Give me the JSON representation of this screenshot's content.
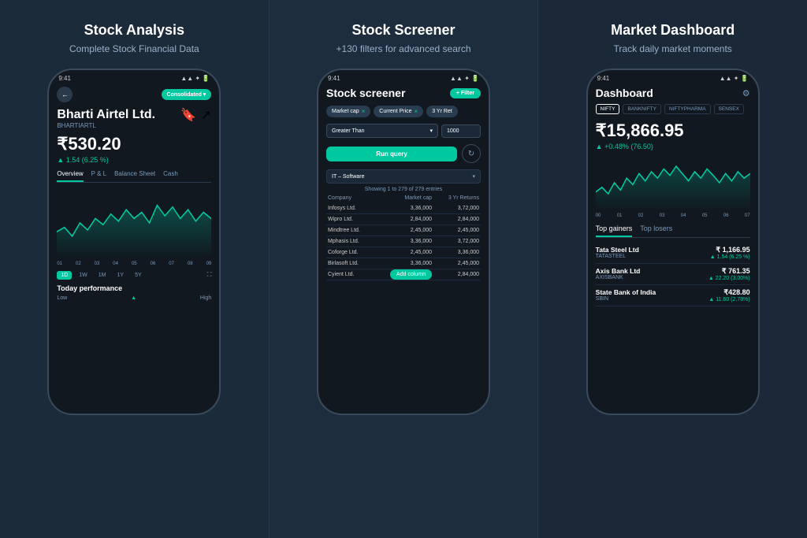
{
  "panels": [
    {
      "id": "panel-1",
      "title": "Stock Analysis",
      "subtitle": "Complete Stock Financial Data",
      "screen": {
        "status_time": "9:41",
        "back_label": "←",
        "badge": "Consolidated ▾",
        "company_name": "Bharti Airtel Ltd.",
        "ticker": "BHARTIARTL",
        "price": "₹530.20",
        "change": "▲ 1.54 (6.25 %)",
        "tabs": [
          "Overview",
          "P & L",
          "Balance Sheet",
          "Cash"
        ],
        "active_tab": "Overview",
        "chart_axis": [
          "01",
          "02",
          "03",
          "04",
          "05",
          "06",
          "07",
          "08",
          "09"
        ],
        "time_buttons": [
          "1D",
          "1W",
          "1M",
          "1Y",
          "5Y"
        ],
        "active_time": "1D",
        "today_perf": "Today performance",
        "perf_low": "Low",
        "perf_high": "High"
      }
    },
    {
      "id": "panel-2",
      "title": "Stock Screener",
      "subtitle": "+130 filters for advanced search",
      "screen": {
        "status_time": "9:41",
        "title": "Stock screener",
        "filter_btn": "+ Filter",
        "tags": [
          "Market cap ×",
          "Current Price ×",
          "3 Yr Ret"
        ],
        "dropdown_label": "Greater Than",
        "input_value": "1000",
        "run_query": "Run query",
        "sector": "IT – Software",
        "count_label": "Showing 1 to 279 of 279 entries",
        "table_headers": [
          "Company",
          "Market cap",
          "3 Yr Returns"
        ],
        "rows": [
          {
            "company": "Infosys Ltd.",
            "mcap": "3,36,000",
            "ret": "3,72,000"
          },
          {
            "company": "Wipro Ltd.",
            "mcap": "2,84,000",
            "ret": "2,84,000"
          },
          {
            "company": "Mindtree Ltd.",
            "mcap": "2,45,000",
            "ret": "2,45,000"
          },
          {
            "company": "Mphasis Ltd.",
            "mcap": "3,36,000",
            "ret": "3,72,000"
          },
          {
            "company": "Coforge Ltd.",
            "mcap": "2,45,000",
            "ret": "3,36,000"
          },
          {
            "company": "Birlasoft Ltd.",
            "mcap": "3,36,000",
            "ret": "2,45,000"
          },
          {
            "company": "Cyient Ltd.",
            "mcap": "",
            "ret": "2,84,000"
          }
        ],
        "add_column": "Add column"
      }
    },
    {
      "id": "panel-3",
      "title": "Market Dashboard",
      "subtitle": "Track daily market moments",
      "screen": {
        "status_time": "9:41",
        "title": "Dashboard",
        "index_tabs": [
          "NIFTY",
          "BANKNIFTY",
          "NIFTYPHARMA",
          "SENSEX"
        ],
        "active_index": "NIFTY",
        "price": "₹15,866.95",
        "change": "▲ +0.48% (76.50)",
        "chart_axis": [
          "00",
          "01",
          "02",
          "03",
          "04",
          "05",
          "06",
          "07"
        ],
        "gl_tabs": [
          "Top gainers",
          "Top losers"
        ],
        "active_gl": "Top gainers",
        "stocks": [
          {
            "name": "Tata Steel Ltd",
            "ticker": "TATASTEEL",
            "price": "₹ 1,166.95",
            "change": "▲ 1.54 (6.25 %)"
          },
          {
            "name": "Axis Bank Ltd",
            "ticker": "AXISBANK",
            "price": "₹ 761.35",
            "change": "▲ 22.20 (3.00%)"
          },
          {
            "name": "State Bank of India",
            "ticker": "SBIN",
            "price": "₹428.80",
            "change": "▲ 11.60 (2.78%)"
          }
        ]
      }
    }
  ]
}
